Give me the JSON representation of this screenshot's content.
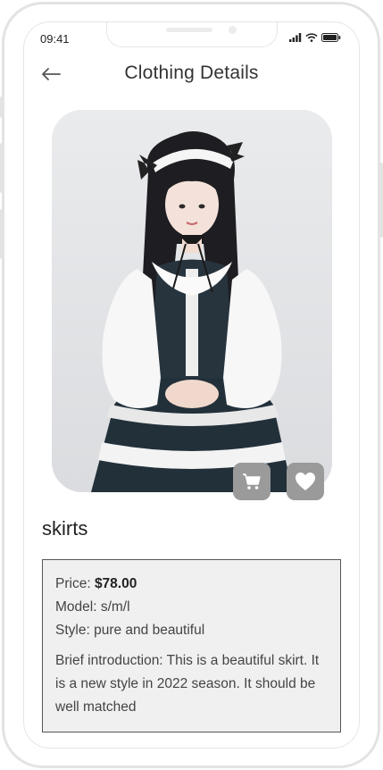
{
  "status_bar": {
    "time": "09:41"
  },
  "header": {
    "title": "Clothing Details"
  },
  "product": {
    "name": "skirts",
    "price_label": "Price:",
    "price_value": "$78.00",
    "model_label": "Model:",
    "model_value": "s/m/l",
    "style_label": "Style:",
    "style_value": "pure and beautiful",
    "intro": "Brief introduction: This is a beautiful skirt. It is a new style in 2022 season. It should be well matched"
  },
  "icons": {
    "back": "arrow-left-icon",
    "cart": "shopping-cart-icon",
    "favorite": "heart-icon"
  },
  "colors": {
    "action_button": "#9a9a9a",
    "info_box_bg": "#f0f0f0",
    "info_box_border": "#555555"
  }
}
